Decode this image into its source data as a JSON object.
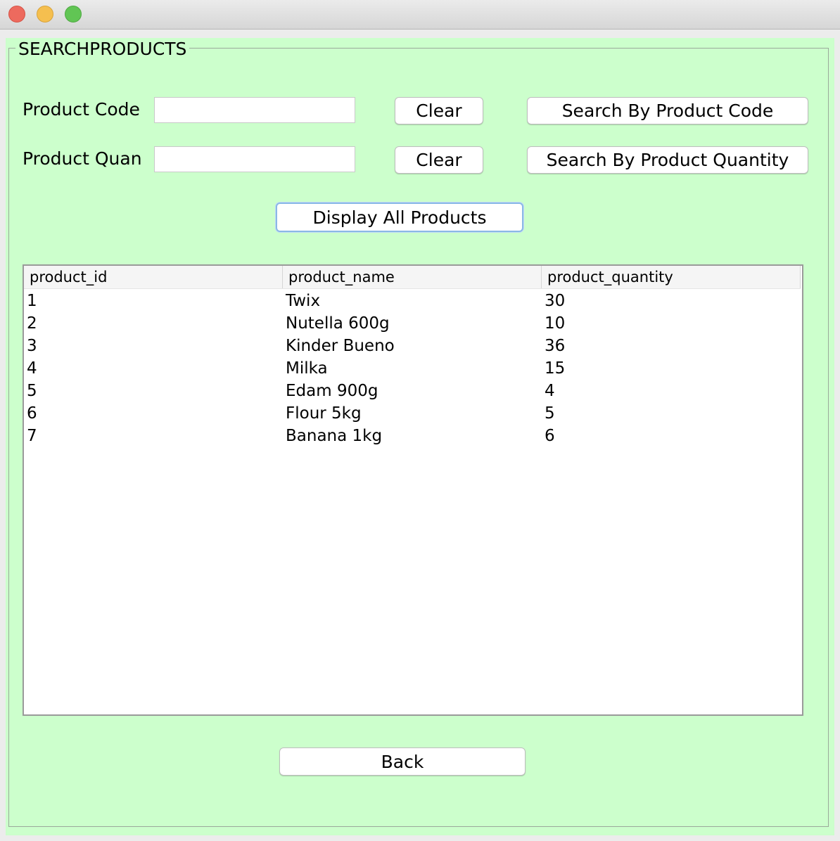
{
  "window": {
    "buttons": [
      "close",
      "minimize",
      "maximize"
    ]
  },
  "panel": {
    "title": "SEARCHPRODUCTS",
    "background": "#ccffcc"
  },
  "code_row": {
    "label": "Product Code",
    "value": "",
    "clear_label": "Clear",
    "search_label": "Search By Product Code"
  },
  "quan_row": {
    "label": "Product Quan",
    "value": "",
    "clear_label": "Clear",
    "search_label": "Search By Product Quantity"
  },
  "display_all_label": "Display All Products",
  "table": {
    "columns": [
      "product_id",
      "product_name",
      "product_quantity"
    ],
    "rows": [
      [
        "1",
        "Twix",
        "30"
      ],
      [
        "2",
        "Nutella 600g",
        "10"
      ],
      [
        "3",
        "Kinder Bueno",
        "36"
      ],
      [
        "4",
        "Milka",
        "15"
      ],
      [
        "5",
        "Edam 900g",
        "4"
      ],
      [
        "6",
        "Flour 5kg",
        "5"
      ],
      [
        "7",
        "Banana 1kg",
        "6"
      ]
    ]
  },
  "back_label": "Back"
}
